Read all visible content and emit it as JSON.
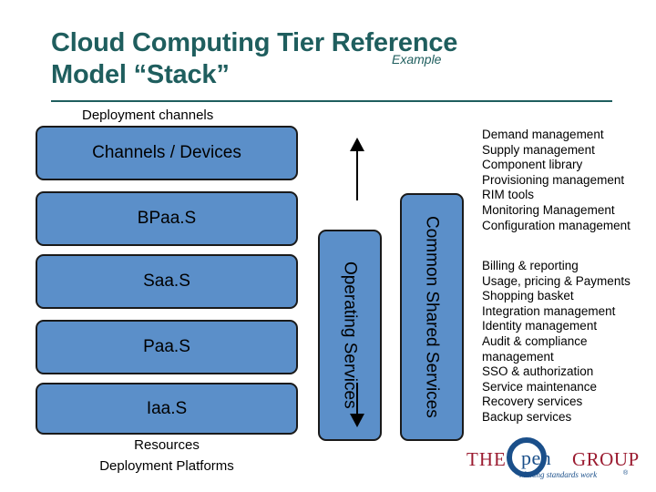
{
  "title": {
    "line1": "Cloud Computing Tier Reference",
    "line2": "Model “Stack”",
    "example": "Example"
  },
  "stack": {
    "header": "Deployment channels",
    "boxes": [
      {
        "label": "Channels / Devices"
      },
      {
        "label": "BPaa.S"
      },
      {
        "label": "Saa.S"
      },
      {
        "label": "Paa.S"
      },
      {
        "label": "Iaa.S"
      }
    ],
    "footer_line1": "Resources",
    "footer_line2": "Deployment Platforms"
  },
  "vertical_boxes": [
    {
      "label": "Operating Services"
    },
    {
      "label": "Common Shared Services"
    }
  ],
  "right_blocks": [
    {
      "items": [
        "Demand management",
        "Supply management",
        "Component library",
        "Provisioning management",
        "RIM tools",
        "Monitoring Management",
        "Configuration management"
      ]
    },
    {
      "items": [
        "Billing & reporting",
        "Usage, pricing & Payments",
        "Shopping basket",
        "Integration management",
        "Identity management",
        "Audit & compliance",
        "management",
        "SSO & authorization",
        "Service maintenance",
        "Recovery services",
        "Backup services"
      ]
    }
  ],
  "logo": {
    "the": "THE",
    "pen": "pen",
    "group": "GROUP",
    "tagline": "Making standards work",
    "registered": "®"
  },
  "colors": {
    "title": "#1f5e5e",
    "box_fill": "#5b8fc9",
    "box_border": "#1a1a1a",
    "logo_red": "#9b1b30",
    "logo_blue": "#1a4f8a"
  }
}
